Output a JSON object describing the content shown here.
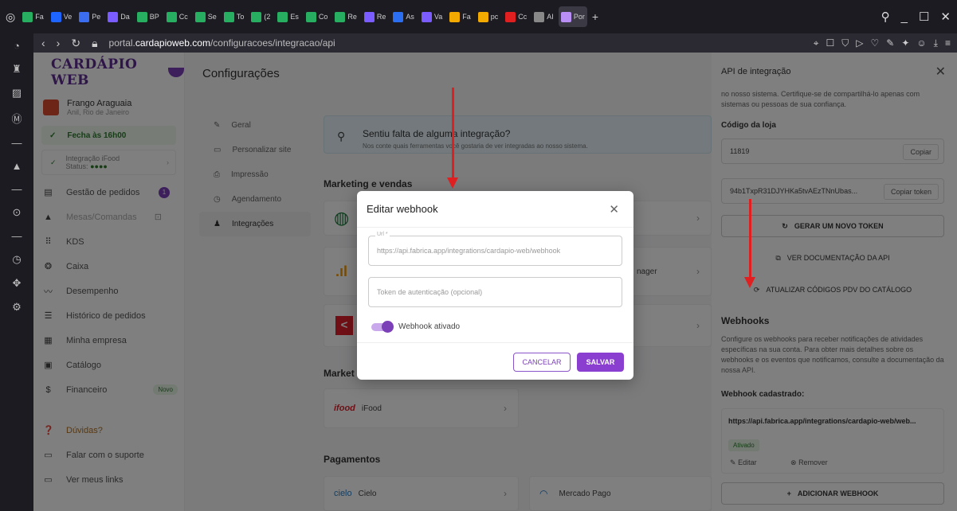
{
  "browser": {
    "tabs": [
      "Fa",
      "Ve",
      "Pe",
      "Da",
      "BP",
      "Cc",
      "Se",
      "To",
      "(2",
      "Es",
      "Co",
      "Re",
      "Re",
      "As",
      "Va",
      "Fa",
      "pc",
      "Cc",
      "AI",
      "Por"
    ],
    "url_prefix": "portal.",
    "url_domain": "cardapioweb.com",
    "url_path": "/configuracoes/integracao/api"
  },
  "app": {
    "logo": "CARDÁPIO WEB",
    "store_name": "Frango Araguaia",
    "store_loc": "Anil, Rio de Janeiro",
    "open_label": "Fecha às 16h00",
    "ifood_label": "Integração iFood",
    "ifood_status": "Status:",
    "menu": [
      {
        "label": "Gestão de pedidos",
        "badge": "1"
      },
      {
        "label": "Mesas/Comandas"
      },
      {
        "label": "KDS"
      },
      {
        "label": "Caixa"
      },
      {
        "label": "Desempenho"
      },
      {
        "label": "Histórico de pedidos"
      },
      {
        "label": "Minha empresa"
      },
      {
        "label": "Catálogo"
      },
      {
        "label": "Financeiro",
        "tag": "Novo"
      },
      {
        "label": "Dúvidas?"
      },
      {
        "label": "Falar com o suporte"
      },
      {
        "label": "Ver meus links"
      }
    ]
  },
  "page": {
    "title": "Configurações",
    "nav": [
      "Geral",
      "Personalizar site",
      "Impressão",
      "Agendamento",
      "Integrações"
    ],
    "banner_title": "Sentiu falta de alguma integração?",
    "banner_desc": "Nos conte quais ferramentas você gostaria de ver integradas ao nosso sistema.",
    "sec_marketing": "Marketing e vendas",
    "sec_market2": "Market",
    "sec_pay": "Pagamentos",
    "card_manager": "nager",
    "card_ifood": "iFood",
    "card_cielo_logo": "cielo",
    "card_cielo": "Cielo",
    "card_mp": "Mercado Pago"
  },
  "modal": {
    "title": "Editar webhook",
    "url_label": "Url *",
    "url_value": "https://api.fabrica.app/integrations/cardapio-web/webhook",
    "token_placeholder": "Token de autenticação (opcional)",
    "toggle_label": "Webhook ativado",
    "toggle_on": true,
    "cancel": "CANCELAR",
    "save": "SALVAR"
  },
  "panel": {
    "title": "API de integração",
    "intro": "no nosso sistema. Certifique-se de compartilhá-lo apenas com sistemas ou pessoas de sua confiança.",
    "store_code_label": "Código da loja",
    "store_code": "11819",
    "copy": "Copiar",
    "token": "94b1TxpR31DJYHKa5tvAEzTNnUbas...",
    "copy_token": "Copiar token",
    "gen_token": "GERAR UM NOVO TOKEN",
    "docs": "VER DOCUMENTAÇÃO DA API",
    "update_pdv": "ATUALIZAR CÓDIGOS PDV DO CATÁLOGO",
    "webhooks_title": "Webhooks",
    "webhooks_desc": "Configure os webhooks para receber notificações de atividades específicas na sua conta. Para obter mais detalhes sobre os webhooks e os eventos que notificamos, consulte a documentação da nossa API.",
    "registered_label": "Webhook cadastrado:",
    "wh_url": "https://api.fabrica.app/integrations/cardapio-web/web...",
    "wh_status": "Ativado",
    "edit": "Editar",
    "remove": "Remover",
    "add": "ADICIONAR WEBHOOK"
  },
  "colors": {
    "brand": "#7b3fb8",
    "arrow": "#e02020"
  }
}
